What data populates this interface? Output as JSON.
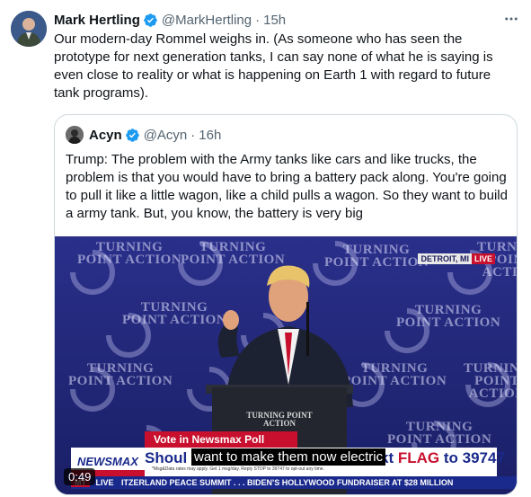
{
  "tweet": {
    "author_name": "Mark Hertling",
    "handle": "@MarkHertling",
    "separator": "·",
    "time": "15h",
    "text": "Our modern-day Rommel weighs in. (As someone who has seen the prototype for next generation tanks, I can say none of what he is saying is even close to reality or what is happening on Earth 1 with regard to future tank programs)."
  },
  "quoted_tweet": {
    "author_name": "Acyn",
    "handle": "@Acyn",
    "separator": "·",
    "time": "16h",
    "text": "Trump: The problem with the Army tanks like cars and like trucks, the problem is that you would have to bring a battery pack along. You're going to pull it like a little wagon, like a child pulls a wagon. So they want to build a army tank. But, you know, the battery is very big"
  },
  "video": {
    "duration": "0:49",
    "caption": "want to make them now electric",
    "location": "DETROIT, MI",
    "live": "LIVE",
    "poll_band": "Vote in Newsmax Poll",
    "network": "NEWSMAX",
    "headline_left": "Shoul",
    "headline_right_prefix": "kt",
    "headline_flag": "FLAG",
    "headline_to": "to 39747",
    "fine_print": "*Msg&Data rates may apply. Get 1 msg/day. Reply STOP to 39747 to opt-out any time.",
    "ticker_tag": "MT",
    "ticker_live": "LIVE",
    "ticker_text": "ITZERLAND PEACE SUMMIT . . .      BIDEN'S HOLLYWOOD FUNDRAISER AT $28 MILLION",
    "backdrop_text_1": "TURNING",
    "backdrop_text_2": "POINT ACTION",
    "podium_text": "TURNING POINT ACTION"
  },
  "colors": {
    "verified": "#1d9bf0",
    "muted": "#536471",
    "border": "#cfd9de",
    "newsmax_red": "#c8102e",
    "newsmax_blue": "#1a2a8c"
  }
}
